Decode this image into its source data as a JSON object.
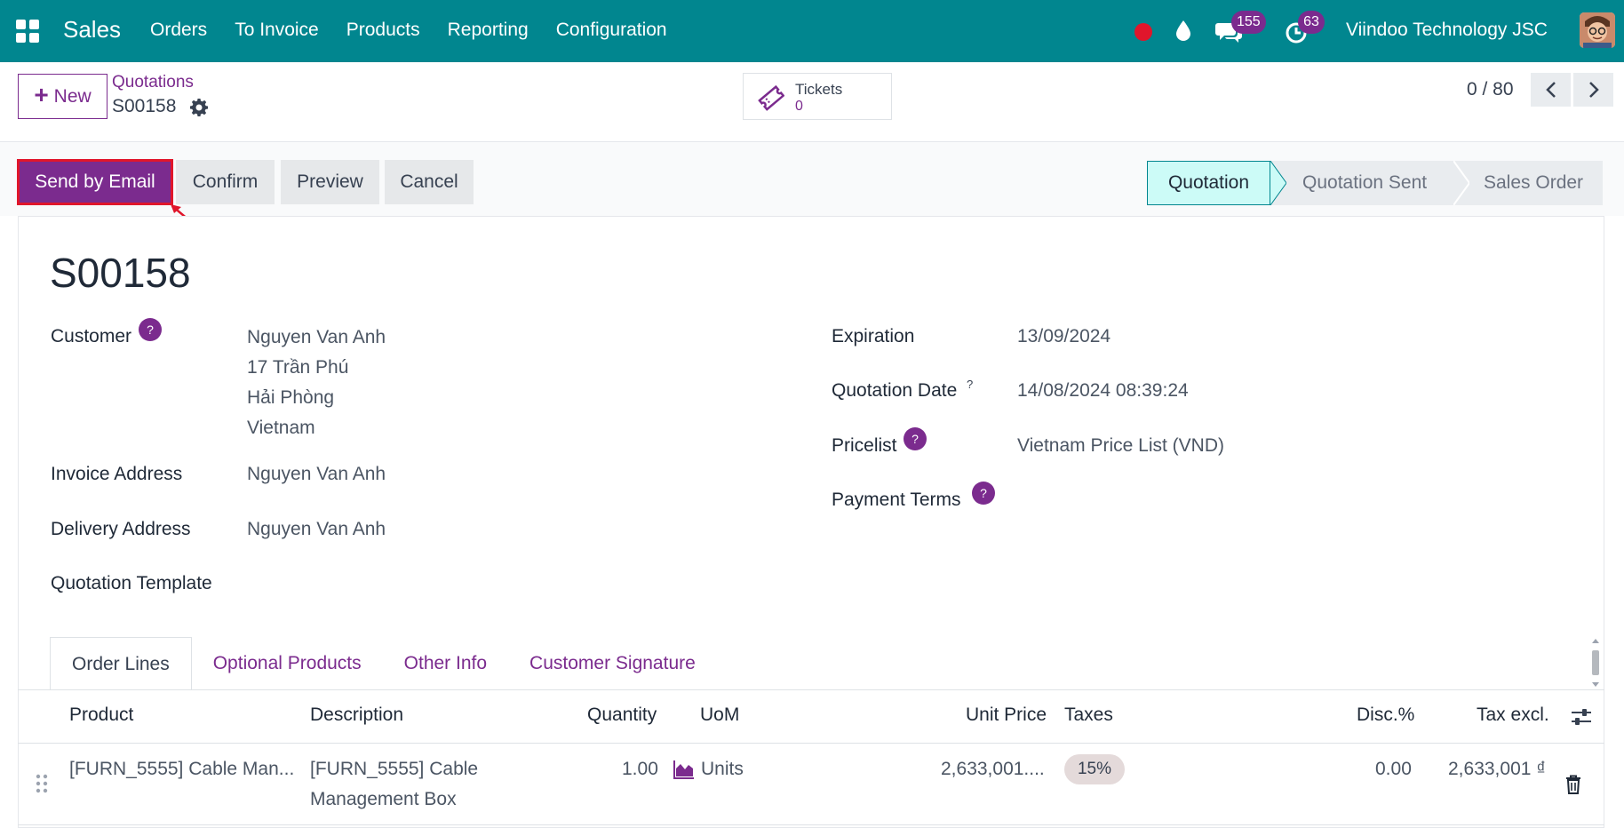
{
  "navbar": {
    "app_name": "Sales",
    "menu": [
      "Orders",
      "To Invoice",
      "Products",
      "Reporting",
      "Configuration"
    ],
    "messages_count": "155",
    "activities_count": "63",
    "company": "Viindoo Technology JSC"
  },
  "breadcrumb": {
    "parent": "Quotations",
    "current": "S00158"
  },
  "control": {
    "new_label": "New",
    "tickets_label": "Tickets",
    "tickets_count": "0",
    "pager": "0 / 80"
  },
  "actions": {
    "send_email": "Send by Email",
    "confirm": "Confirm",
    "preview": "Preview",
    "cancel": "Cancel"
  },
  "status": {
    "stages": [
      "Quotation",
      "Quotation Sent",
      "Sales Order"
    ],
    "active": "Quotation"
  },
  "form": {
    "title": "S00158",
    "customer_label": "Customer",
    "customer_lines": [
      "Nguyen Van Anh",
      "17 Trần Phú",
      "Hải Phòng",
      "Vietnam"
    ],
    "invoice_address_label": "Invoice Address",
    "invoice_address": "Nguyen Van Anh",
    "delivery_address_label": "Delivery Address",
    "delivery_address": "Nguyen Van Anh",
    "quotation_template_label": "Quotation Template",
    "expiration_label": "Expiration",
    "expiration": "13/09/2024",
    "quotation_date_label": "Quotation Date",
    "quotation_date": "14/08/2024 08:39:24",
    "pricelist_label": "Pricelist",
    "pricelist": "Vietnam Price List (VND)",
    "payment_terms_label": "Payment Terms",
    "help_glyph": "?"
  },
  "tabs": [
    "Order Lines",
    "Optional Products",
    "Other Info",
    "Customer Signature"
  ],
  "table": {
    "headers": {
      "product": "Product",
      "description": "Description",
      "quantity": "Quantity",
      "uom": "UoM",
      "unit_price": "Unit Price",
      "taxes": "Taxes",
      "discount": "Disc.%",
      "subtotal": "Tax excl."
    },
    "rows": [
      {
        "product": "[FURN_5555] Cable Man...",
        "description_1": "[FURN_5555] Cable",
        "description_2": "Management Box",
        "quantity": "1.00",
        "uom": "Units",
        "unit_price": "2,633,001....",
        "taxes": "15%",
        "discount": "0.00",
        "subtotal": "2,633,001 ₫"
      }
    ]
  },
  "colors": {
    "navbar": "#01868f",
    "primary": "#7b2b8e",
    "highlight": "#e0162b",
    "active_stage": "#ccfbf7"
  }
}
